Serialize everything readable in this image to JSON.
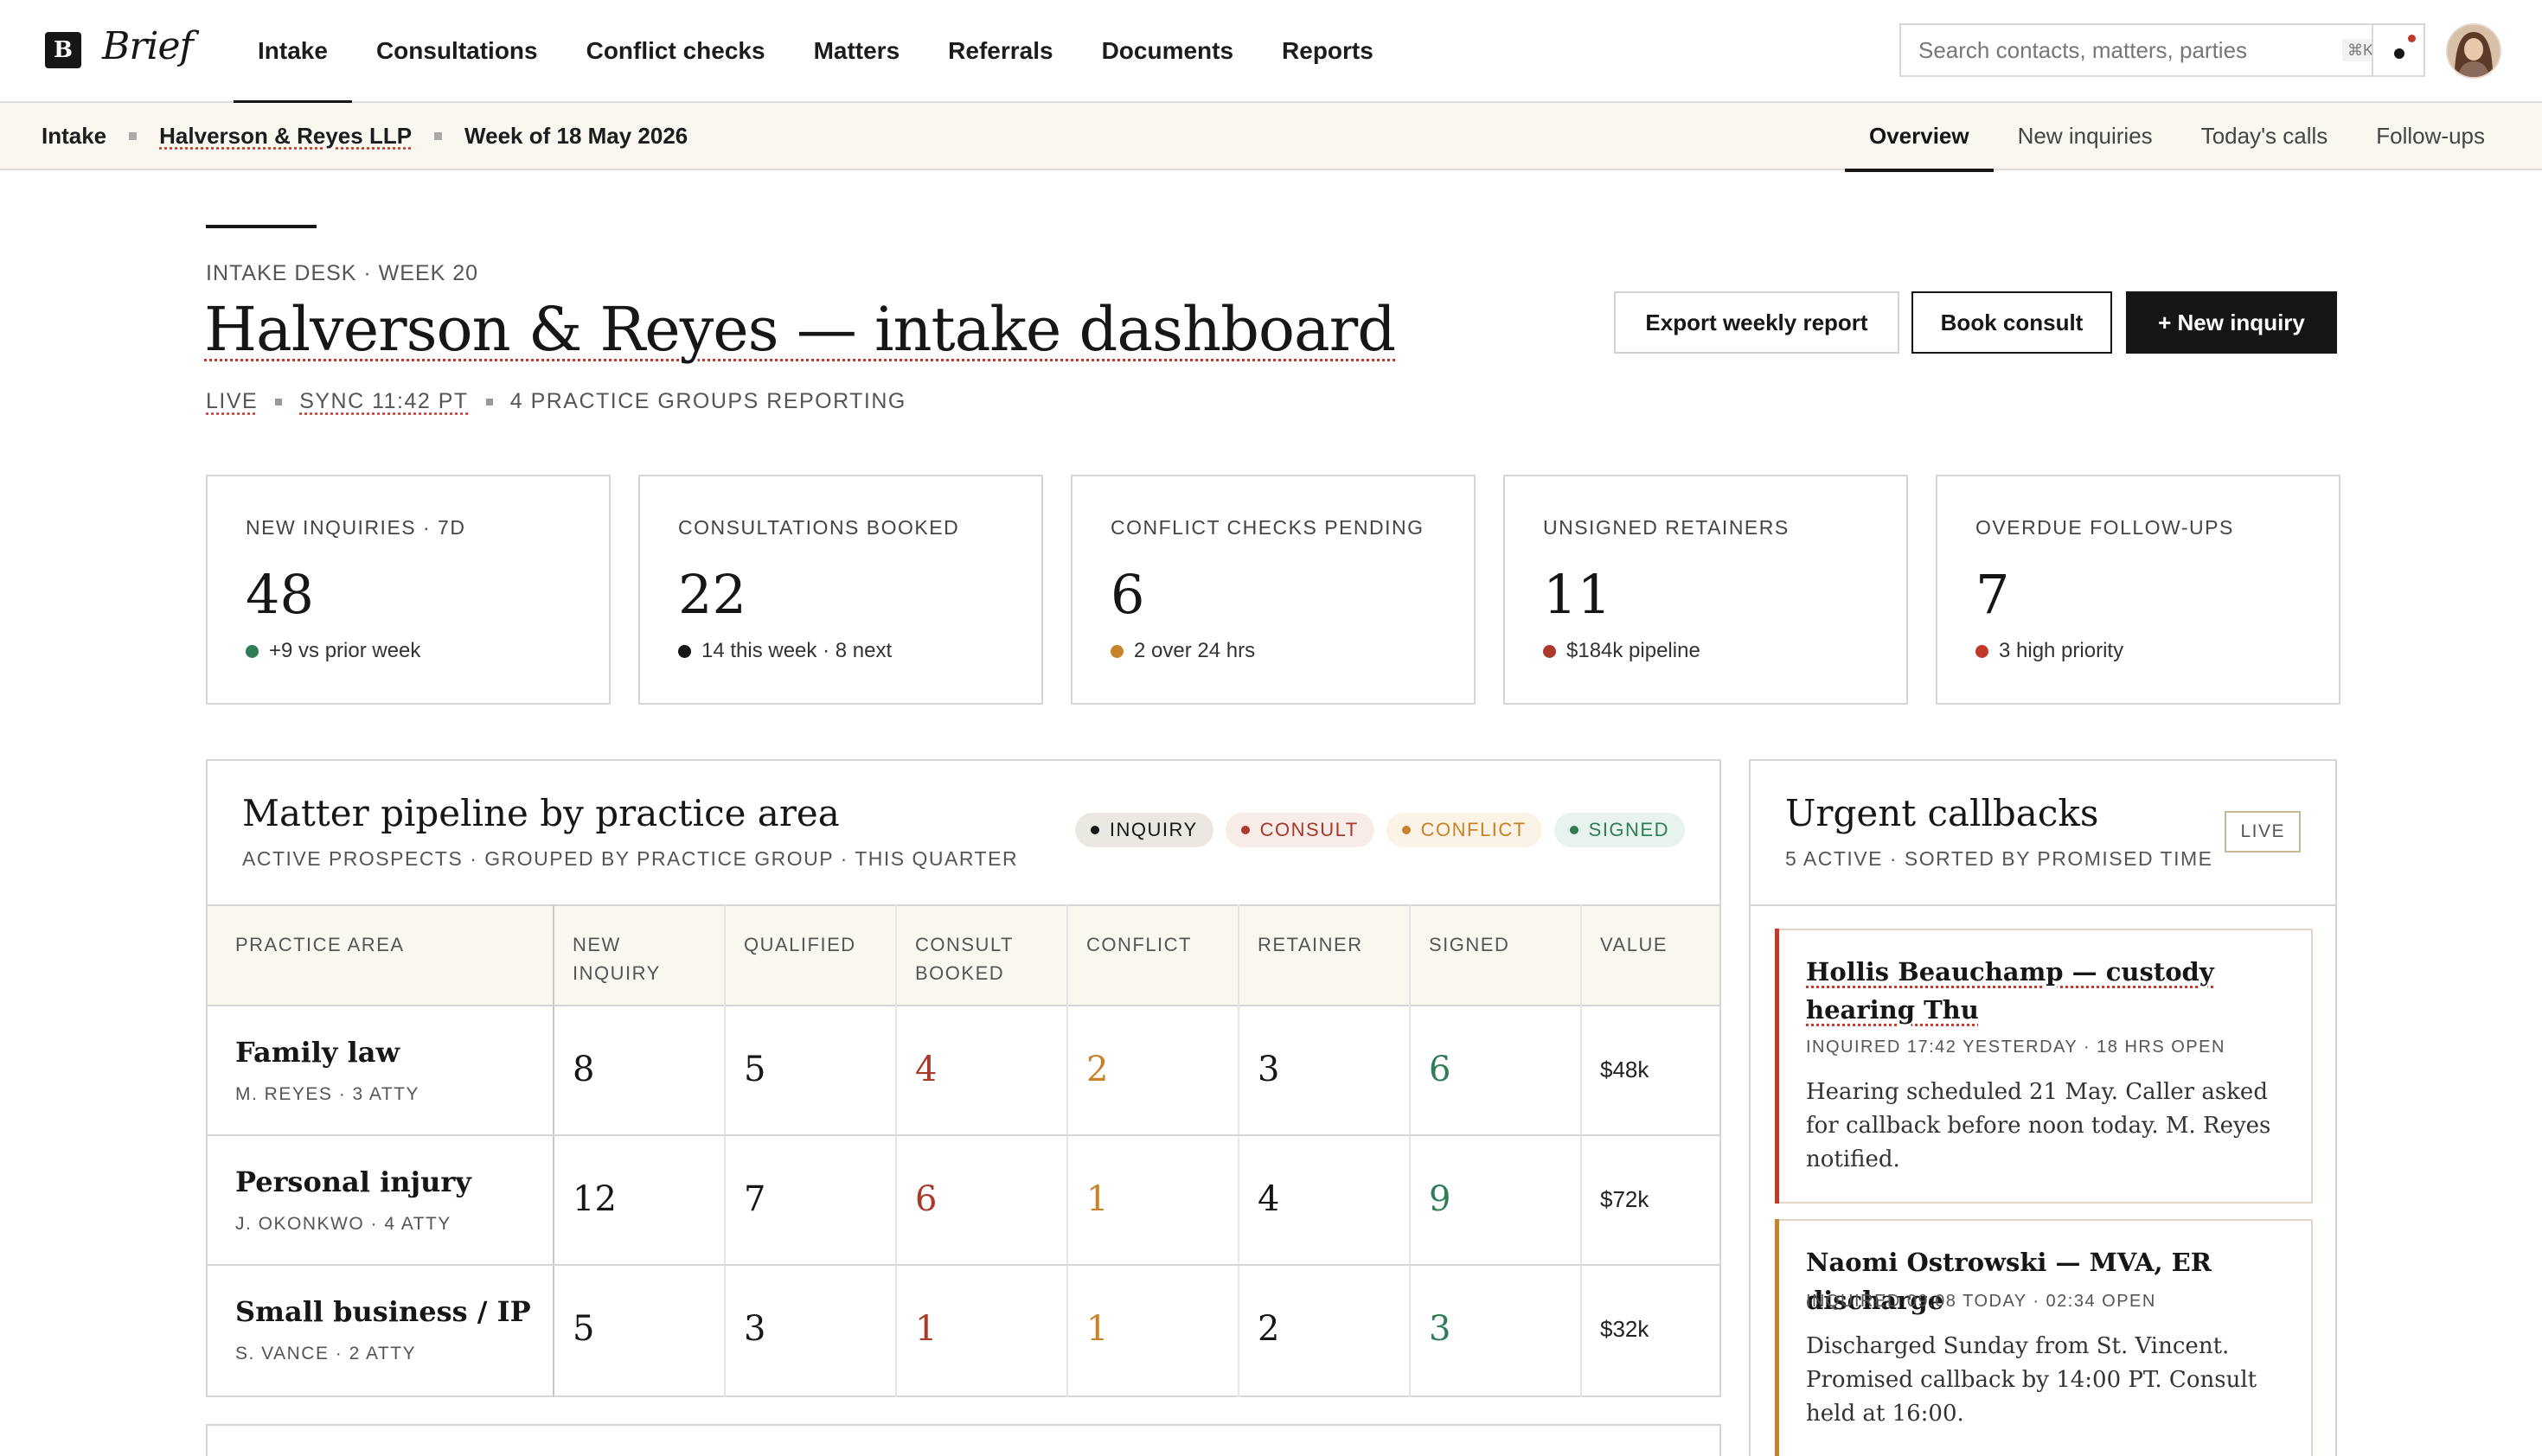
{
  "brand": {
    "mark": "B",
    "name": "Brief"
  },
  "nav": {
    "items": [
      "Intake",
      "Consultations",
      "Conflict checks",
      "Matters",
      "Referrals",
      "Documents",
      "Reports"
    ],
    "active": "Intake"
  },
  "search": {
    "placeholder": "Search contacts, matters, parties",
    "shortcut": "⌘K"
  },
  "breadcrumb": {
    "section": "Intake",
    "firm": "Halverson & Reyes LLP",
    "period": "Week of 18 May 2026"
  },
  "subtabs": {
    "items": [
      "Overview",
      "New inquiries",
      "Today's calls",
      "Follow-ups"
    ],
    "active": "Overview"
  },
  "header": {
    "eyebrow": "INTAKE DESK · WEEK 20",
    "title": "Halverson & Reyes — intake dashboard",
    "meta_live": "LIVE",
    "meta_sync": "SYNC 11:42 PT",
    "meta_groups": "4 PRACTICE GROUPS REPORTING"
  },
  "actions": {
    "export": "Export weekly report",
    "book": "Book consult",
    "new": "+ New inquiry"
  },
  "stats": [
    {
      "label": "NEW INQUIRIES · 7D",
      "value": "48",
      "note": "+9 vs prior week",
      "color": "#2e7d55"
    },
    {
      "label": "CONSULTATIONS BOOKED",
      "value": "22",
      "note": "14 this week · 8 next",
      "color": "#161616"
    },
    {
      "label": "CONFLICT CHECKS PENDING",
      "value": "6",
      "note": "2 over 24 hrs",
      "color": "#c8832a"
    },
    {
      "label": "UNSIGNED RETAINERS",
      "value": "11",
      "note": "$184k pipeline",
      "color": "#a8392b"
    },
    {
      "label": "OVERDUE FOLLOW-UPS",
      "value": "7",
      "note": "3 high priority",
      "color": "#c0392b"
    }
  ],
  "pipeline": {
    "title": "Matter pipeline by practice area",
    "subtitle": "ACTIVE PROSPECTS · GROUPED BY PRACTICE GROUP · THIS QUARTER",
    "legend": [
      {
        "label": "INQUIRY",
        "color": "#161616",
        "bg": "#ebe7e1"
      },
      {
        "label": "CONSULT",
        "color": "#a8392b",
        "bg": "#f7ece7"
      },
      {
        "label": "CONFLICT",
        "color": "#c8832a",
        "bg": "#fbf3e6"
      },
      {
        "label": "SIGNED",
        "color": "#2e7d55",
        "bg": "#e9f3ed"
      }
    ],
    "columns": [
      "PRACTICE AREA",
      "NEW INQUIRY",
      "QUALIFIED",
      "CONSULT BOOKED",
      "CONFLICT",
      "RETAINER",
      "SIGNED",
      "VALUE"
    ],
    "rows": [
      {
        "area": "Family law",
        "lead": "M. REYES · 3 ATTY",
        "new": "8",
        "qualified": "5",
        "consult": "4",
        "conflict": "2",
        "retainer": "3",
        "signed": "6",
        "value": "$48k"
      },
      {
        "area": "Personal injury",
        "lead": "J. OKONKWO · 4 ATTY",
        "new": "12",
        "qualified": "7",
        "consult": "6",
        "conflict": "1",
        "retainer": "4",
        "signed": "9",
        "value": "$72k"
      },
      {
        "area": "Small business / IP",
        "lead": "S. VANCE · 2 ATTY",
        "new": "5",
        "qualified": "3",
        "consult": "1",
        "conflict": "1",
        "retainer": "2",
        "signed": "3",
        "value": "$32k"
      }
    ]
  },
  "urgent": {
    "title": "Urgent callbacks",
    "subtitle": "5 ACTIVE · SORTED BY PROMISED TIME",
    "badge": "LIVE",
    "items": [
      {
        "title": "Hollis Beauchamp — custody hearing Thu",
        "meta": "INQUIRED 17:42 YESTERDAY · 18 HRS OPEN",
        "body": "Hearing scheduled 21 May. Caller asked for callback before noon today. M. Reyes notified.",
        "accent": "#c0392b"
      },
      {
        "title": "Naomi Ostrowski — MVA, ER discharge",
        "meta": "INQUIRED 09:08 TODAY · 02:34 OPEN",
        "body": "Discharged Sunday from St. Vincent. Promised callback by 14:00 PT. Consult held at 16:00.",
        "accent": "#c8832a"
      }
    ]
  }
}
